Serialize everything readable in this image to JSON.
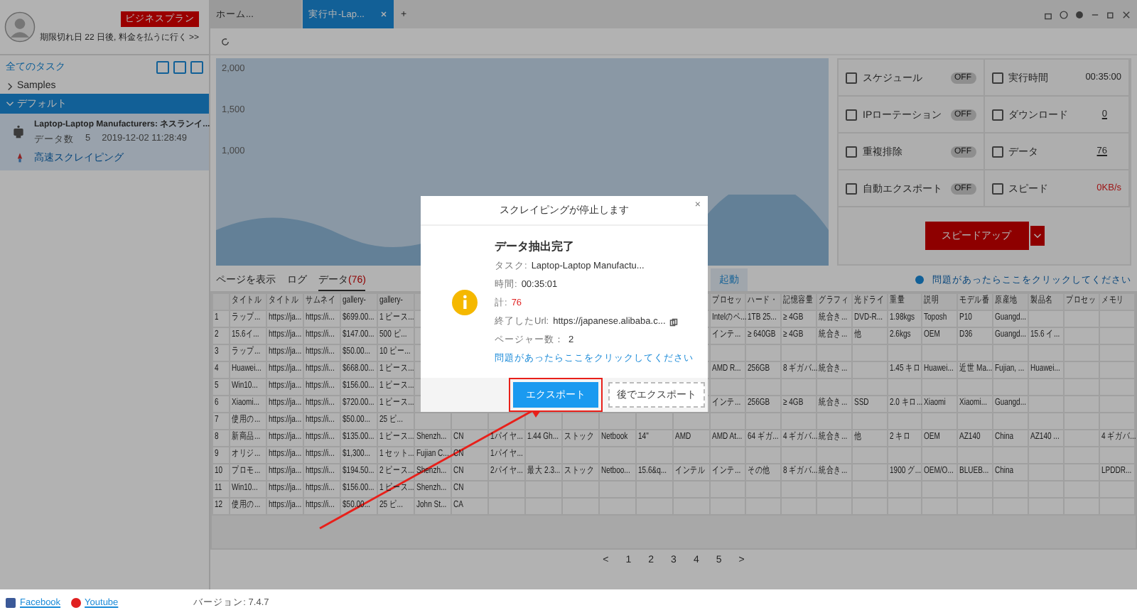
{
  "sidebar": {
    "plan_badge": "ビジネスプラン",
    "expiry": "期限切れ日 22 日後, 料金を払うに行く >>",
    "all_tasks": "全てのタスク",
    "folders": [
      {
        "name": "Samples",
        "expanded": false,
        "selected": false
      },
      {
        "name": "デフォルト",
        "expanded": true,
        "selected": true
      }
    ],
    "task": {
      "title": "Laptop-Laptop Manufacturers: ネスランイ...",
      "data_label": "データ数",
      "data_count": "5",
      "time": "2019-12-02 11:28:49",
      "link": "高速スクレイピング"
    },
    "footer": {
      "links": [
        "Facebook",
        "Youtube"
      ],
      "version": "バージョン: 7.4.7"
    }
  },
  "tabs": [
    {
      "label": "ホーム...",
      "selected": false,
      "closable": false
    },
    {
      "label": "実行中-Lap...",
      "selected": true,
      "closable": true
    }
  ],
  "tab_add": "+",
  "chart": {
    "y_labels": [
      "2,000",
      "1,500",
      "1,000"
    ]
  },
  "stats": [
    {
      "label": "スケジュール",
      "kind": "toggle",
      "on": false,
      "value": "OFF"
    },
    {
      "label": "実行時間",
      "kind": "value",
      "value": "00:35:00"
    },
    {
      "label": "IPローテーション",
      "kind": "toggle",
      "on": false,
      "value": "OFF"
    },
    {
      "label": "ダウンロード",
      "kind": "link",
      "value": "0"
    },
    {
      "label": "重複排除",
      "kind": "toggle",
      "on": false,
      "value": "OFF"
    },
    {
      "label": "データ",
      "kind": "link",
      "value": "76"
    },
    {
      "label": "自動エクスポート",
      "kind": "toggle",
      "on": false,
      "value": "OFF"
    },
    {
      "label": "スピード",
      "kind": "alert",
      "value": "0KB/s"
    }
  ],
  "speed_button": "スピードアップ",
  "data_tabs": [
    {
      "label": "ページを表示",
      "selected": false
    },
    {
      "label": "ログ",
      "selected": false
    },
    {
      "label": "データ",
      "count": "(76)",
      "selected": true
    }
  ],
  "start_button": "起動",
  "help_link": "問題があったらここをクリックしてください",
  "table": {
    "columns": [
      "",
      "タイトル",
      "タイトル",
      "サムネイ",
      "gallery-",
      "gallery-",
      null,
      null,
      null,
      null,
      null,
      null,
      null,
      null,
      "プロセッ",
      "ハード・",
      "記憶容量",
      "グラフィ",
      "光ドライ",
      "重量",
      "説明",
      "モデル番",
      "原産地",
      "製品名",
      "プロセッ",
      "メモリ"
    ],
    "rows": [
      [
        "1",
        "ラップ...",
        "https://ja...",
        "https://i...",
        "$699.00...",
        "1 ピース...",
        null,
        null,
        null,
        null,
        null,
        null,
        null,
        null,
        "Intelのペ...",
        "1TB 25...",
        "≥ 4GB",
        "統合き...",
        "DVD-R...",
        "1.98kgs",
        "Toposh",
        "P10",
        "Guangd...",
        null,
        null,
        null
      ],
      [
        "2",
        "15.6イ...",
        "https://ja...",
        "https://i...",
        "$147.00...",
        "500 ピ...",
        null,
        null,
        null,
        null,
        null,
        null,
        null,
        null,
        "インテ...",
        "≥ 640GB",
        "≥ 4GB",
        "統合き...",
        "他",
        "2.6kgs",
        "OEM",
        "D36",
        "Guangd...",
        "15.6 イ...",
        null,
        null
      ],
      [
        "3",
        "ラップ...",
        "https://ja...",
        "https://i...",
        "$50.00...",
        "10 ピー...",
        null,
        null,
        null,
        null,
        null,
        null,
        null,
        null,
        null,
        null,
        null,
        null,
        null,
        null,
        null,
        null,
        null,
        null,
        null,
        null
      ],
      [
        "4",
        "Huawei...",
        "https://ja...",
        "https://i...",
        "$668.00...",
        "1 ピース...",
        null,
        null,
        null,
        null,
        null,
        null,
        null,
        null,
        "AMD R...",
        "256GB",
        "8 ギガバ...",
        "統合き...",
        null,
        "1.45 キロ",
        "Huawei...",
        "近世 Ma...",
        "Fujian, ...",
        "Huawei...",
        null,
        null
      ],
      [
        "5",
        "Win10...",
        "https://ja...",
        "https://i...",
        "$156.00...",
        "1 ピース...",
        null,
        null,
        null,
        null,
        null,
        null,
        null,
        null,
        null,
        null,
        null,
        null,
        null,
        null,
        null,
        null,
        null,
        null,
        null,
        null
      ],
      [
        "6",
        "Xiaomi...",
        "https://ja...",
        "https://i...",
        "$720.00...",
        "1 ピース...",
        null,
        null,
        null,
        null,
        null,
        null,
        null,
        null,
        "インテ...",
        "256GB",
        "≥ 4GB",
        "統合き...",
        "SSD",
        "2.0 キロ...",
        "Xiaomi",
        "Xiaomi...",
        "Guangd...",
        null,
        null,
        null
      ],
      [
        "7",
        "使用の...",
        "https://ja...",
        "https://i...",
        "$50.00...",
        "25 ピ...",
        null,
        null,
        null,
        null,
        null,
        null,
        null,
        null,
        null,
        null,
        null,
        null,
        null,
        null,
        null,
        null,
        null,
        null,
        null,
        null
      ],
      [
        "8",
        "新商品...",
        "https://ja...",
        "https://i...",
        "$135.00...",
        "1 ピース...",
        "Shenzh...",
        "CN",
        "1パイヤ...",
        "1.44 Gh...",
        "ストック",
        "Netbook",
        "14\"",
        "AMD",
        "AMD At...",
        "64 ギガ...",
        "4 ギガバ...",
        "統合き...",
        "他",
        "2 キロ",
        "OEM",
        "AZ140",
        "China",
        "AZ140 ...",
        null,
        "4 ギガバ..."
      ],
      [
        "9",
        "オリジ...",
        "https://ja...",
        "https://i...",
        "$1,300...",
        "1 セット...",
        "Fujian C...",
        "CN",
        "1パイヤ...",
        null,
        null,
        null,
        null,
        null,
        null,
        null,
        null,
        null,
        null,
        null,
        null,
        null,
        null,
        null,
        null,
        null
      ],
      [
        "10",
        "プロモ...",
        "https://ja...",
        "https://i...",
        "$194.50...",
        "2 ピース...",
        "Shenzh...",
        "CN",
        "2パイヤ...",
        "最大 2.3...",
        "ストック",
        "Netboo...",
        "15.6&q...",
        "インテル",
        "インテ...",
        "その他",
        "8 ギガバ...",
        "統合き...",
        null,
        "1900 グ...",
        "OEM/O...",
        "BLUEB...",
        "China",
        null,
        null,
        "LPDDR..."
      ],
      [
        "11",
        "Win10...",
        "https://ja...",
        "https://i...",
        "$156.00...",
        "1 ピース...",
        "Shenzh...",
        "CN",
        null,
        null,
        null,
        null,
        null,
        null,
        null,
        null,
        null,
        null,
        null,
        null,
        null,
        null,
        null,
        null,
        null,
        null
      ],
      [
        "12",
        "使用の...",
        "https://ja...",
        "https://i...",
        "$50.00...",
        "25 ピ...",
        "John St...",
        "CA",
        null,
        null,
        null,
        null,
        null,
        null,
        null,
        null,
        null,
        null,
        null,
        null,
        null,
        null,
        null,
        null,
        null,
        null
      ]
    ]
  },
  "pagination": [
    "<",
    "1",
    "2",
    "3",
    "4",
    "5",
    ">"
  ],
  "dialog": {
    "title": "スクレイピングが停止します",
    "close": "×",
    "heading": "データ抽出完了",
    "lines": [
      {
        "label": "タスク:",
        "value": "Laptop-Laptop Manufactu...",
        "kind": "text"
      },
      {
        "label": "時間:",
        "value": "00:35:01",
        "kind": "text"
      },
      {
        "label": "計:",
        "value": "76",
        "kind": "alert"
      },
      {
        "label": "終了したUrl:",
        "value": "https://japanese.alibaba.c...",
        "kind": "copy"
      },
      {
        "label": "ページャー数：",
        "value": "2",
        "kind": "text"
      }
    ],
    "help_link": "問題があったらここをクリックしてください",
    "buttons": [
      {
        "label": "エクスポート",
        "primary": true,
        "highlighted": true
      },
      {
        "label": "後でエクスポート",
        "primary": false,
        "highlighted": false
      }
    ]
  },
  "annotation_arrow": true
}
